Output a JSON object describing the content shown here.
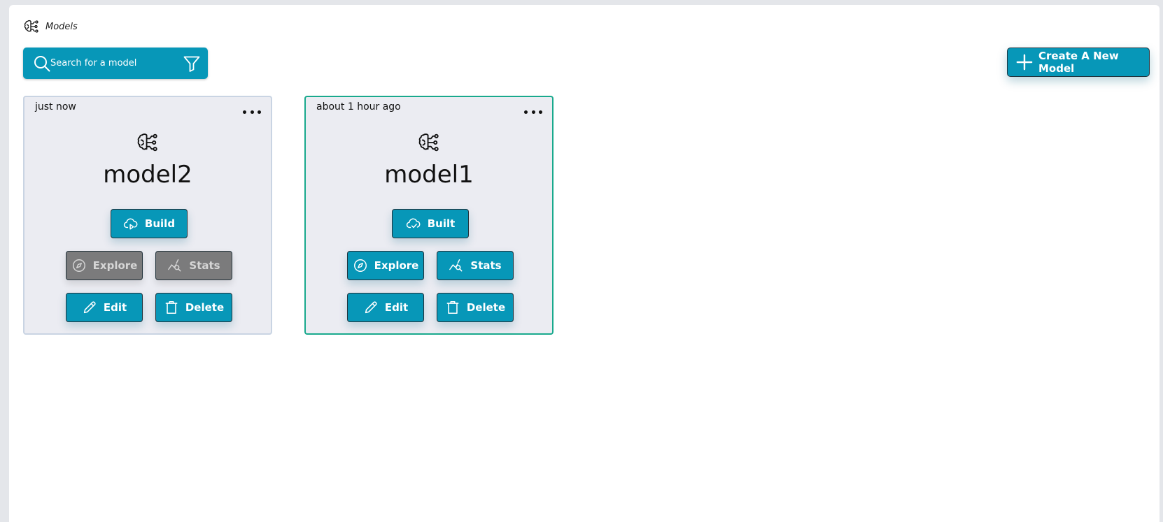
{
  "breadcrumb": {
    "label": "Models",
    "icon": "brain-circuit-icon"
  },
  "search": {
    "placeholder": "Search for a model",
    "icon": "search-icon",
    "filter_icon": "filter-icon"
  },
  "create_button": {
    "label": "Create A New Model",
    "icon": "plus-icon"
  },
  "colors": {
    "accent": "#0797b8",
    "disabled": "#7b7b7c",
    "selected_border": "#19a98d",
    "card_bg": "#ebecf2"
  },
  "models": [
    {
      "time": "just now",
      "name": "model2",
      "status_label": "Build",
      "status_icon": "cloud-upload-icon",
      "explore_label": "Explore",
      "stats_label": "Stats",
      "edit_label": "Edit",
      "delete_label": "Delete",
      "explore_enabled": false,
      "stats_enabled": false,
      "selected": false
    },
    {
      "time": "about 1 hour ago",
      "name": "model1",
      "status_label": "Built",
      "status_icon": "cloud-check-icon",
      "explore_label": "Explore",
      "stats_label": "Stats",
      "edit_label": "Edit",
      "delete_label": "Delete",
      "explore_enabled": true,
      "stats_enabled": true,
      "selected": true
    }
  ]
}
